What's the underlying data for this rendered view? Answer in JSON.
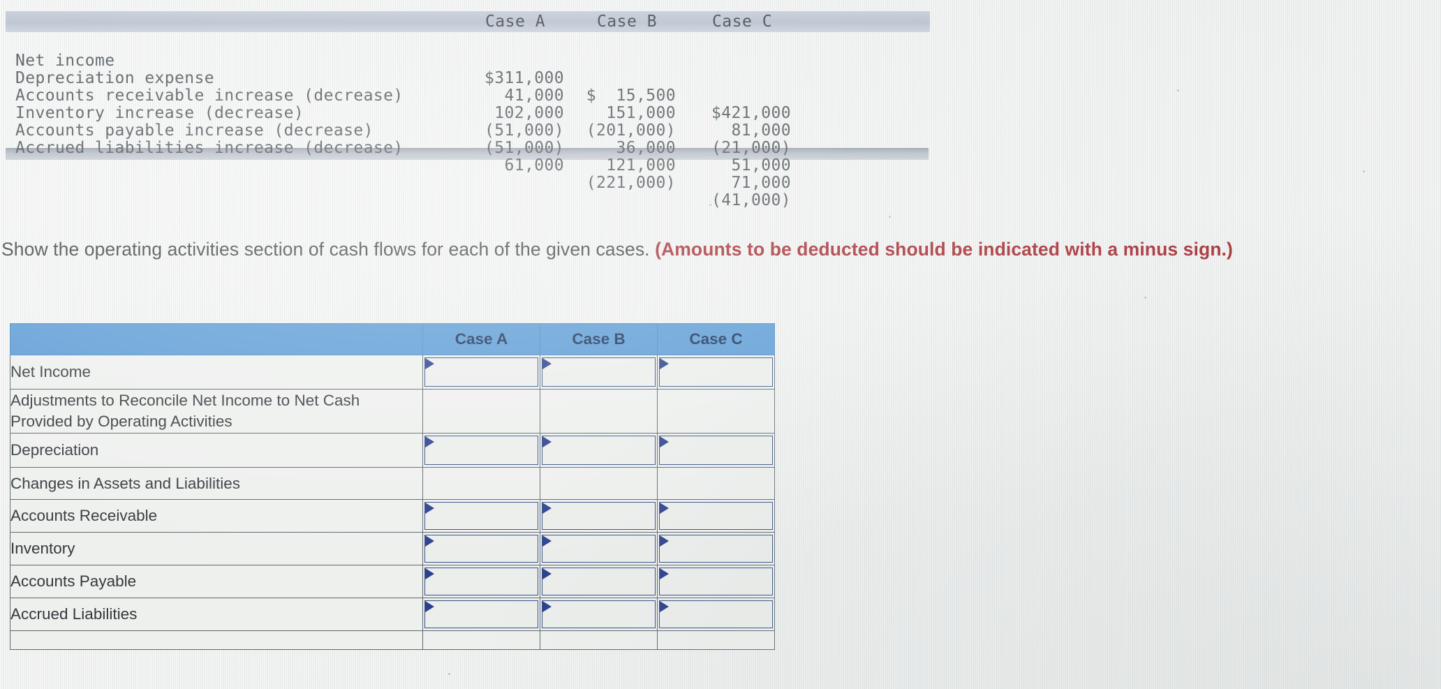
{
  "given_table": {
    "columns": [
      "Case A",
      "Case B",
      "Case C"
    ],
    "rows": [
      {
        "label": "Net income",
        "case_a": "$311,000",
        "case_b": "$  15,500",
        "case_c": "$421,000"
      },
      {
        "label": "Depreciation expense",
        "case_a": "41,000",
        "case_b": "151,000",
        "case_c": "81,000"
      },
      {
        "label": "Accounts receivable increase (decrease)",
        "case_a": "102,000",
        "case_b": "(201,000)",
        "case_c": "(21,000)"
      },
      {
        "label": "Inventory increase (decrease)",
        "case_a": "(51,000)",
        "case_b": "36,000",
        "case_c": "51,000"
      },
      {
        "label": "Accounts payable increase (decrease)",
        "case_a": "(51,000)",
        "case_b": "121,000",
        "case_c": "71,000"
      },
      {
        "label": "Accrued liabilities increase (decrease)",
        "case_a": "61,000",
        "case_b": "(221,000)",
        "case_c": "(41,000)"
      }
    ]
  },
  "prompt": {
    "plain": "Show the operating activities section of cash flows for each of the given cases. ",
    "emphasis": "(Amounts to be deducted should be indicated with a minus sign.)"
  },
  "answer_table": {
    "header": {
      "blank": "",
      "case_a": "Case A",
      "case_b": "Case B",
      "case_c": "Case C"
    },
    "rows": [
      {
        "label": "Net Income",
        "indent": 0,
        "entry": true
      },
      {
        "label": "Adjustments to Reconcile Net Income to Net Cash Provided by Operating Activities",
        "indent": 0,
        "entry": false
      },
      {
        "label": "Depreciation",
        "indent": 1,
        "entry": true
      },
      {
        "label": "Changes in Assets and Liabilities",
        "indent": 0,
        "entry": false
      },
      {
        "label": "Accounts Receivable",
        "indent": 1,
        "entry": true
      },
      {
        "label": "Inventory",
        "indent": 1,
        "entry": true
      },
      {
        "label": "Accounts Payable",
        "indent": 1,
        "entry": true
      },
      {
        "label": "Accrued Liabilities",
        "indent": 1,
        "entry": true
      }
    ],
    "cell_values": {
      "case_a": [
        "",
        "",
        "",
        "",
        "",
        "",
        "",
        ""
      ],
      "case_b": [
        "",
        "",
        "",
        "",
        "",
        "",
        "",
        ""
      ],
      "case_c": [
        "",
        "",
        "",
        "",
        "",
        "",
        "",
        ""
      ]
    }
  },
  "colors": {
    "header_blue": "#5b9bd5",
    "header_blue_text": "#17315c",
    "given_band": "#b6bfcd",
    "emphasis_red": "#a42b32",
    "entry_border_blue": "#2f4e86",
    "page_background": "#eef0ef"
  }
}
